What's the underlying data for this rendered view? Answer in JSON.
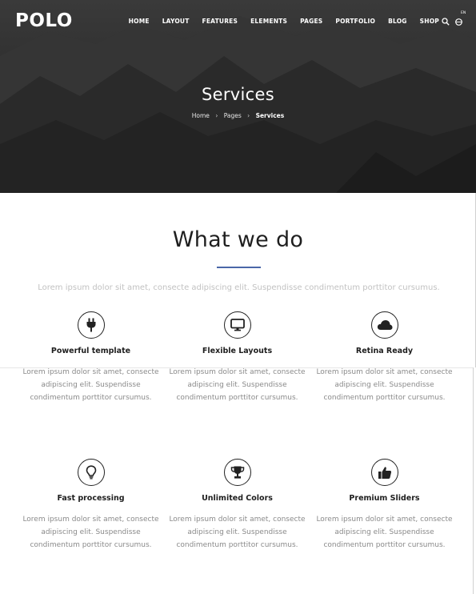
{
  "brand": {
    "logo": "POLO"
  },
  "nav": {
    "items": [
      "HOME",
      "LAYOUT",
      "FEATURES",
      "ELEMENTS",
      "PAGES",
      "PORTFOLIO",
      "BLOG",
      "SHOP"
    ],
    "icons": [
      "search-icon",
      "language-icon"
    ],
    "language_badge": "EN"
  },
  "hero": {
    "title": "Services",
    "breadcrumb": [
      "Home",
      "Pages",
      "Services"
    ]
  },
  "section": {
    "title": "What we do",
    "lead": "Lorem ipsum dolor sit amet, consecte adipiscing elit. Suspendisse condimentum porttitor cursumus."
  },
  "features": [
    {
      "icon": "plug-icon",
      "title": "Powerful template",
      "desc": "Lorem ipsum dolor sit amet, consecte adipiscing elit. Suspendisse condimentum porttitor cursumus."
    },
    {
      "icon": "monitor-icon",
      "title": "Flexible Layouts",
      "desc": "Lorem ipsum dolor sit amet, consecte adipiscing elit. Suspendisse condimentum porttitor cursumus."
    },
    {
      "icon": "cloud-icon",
      "title": "Retina Ready",
      "desc": "Lorem ipsum dolor sit amet, consecte adipiscing elit. Suspendisse condimentum porttitor cursumus."
    },
    {
      "icon": "lightbulb-icon",
      "title": "Fast processing",
      "desc": "Lorem ipsum dolor sit amet, consecte adipiscing elit. Suspendisse condimentum porttitor cursumus."
    },
    {
      "icon": "trophy-icon",
      "title": "Unlimited Colors",
      "desc": "Lorem ipsum dolor sit amet, consecte adipiscing elit. Suspendisse condimentum porttitor cursumus."
    },
    {
      "icon": "thumbs-up-icon",
      "title": "Premium Sliders",
      "desc": "Lorem ipsum dolor sit amet, consecte adipiscing elit. Suspendisse condimentum porttitor cursumus."
    }
  ],
  "colors": {
    "accent": "#4a67a8",
    "hero_bg": "#2b2b2b",
    "text_muted": "#8a8a8a"
  }
}
